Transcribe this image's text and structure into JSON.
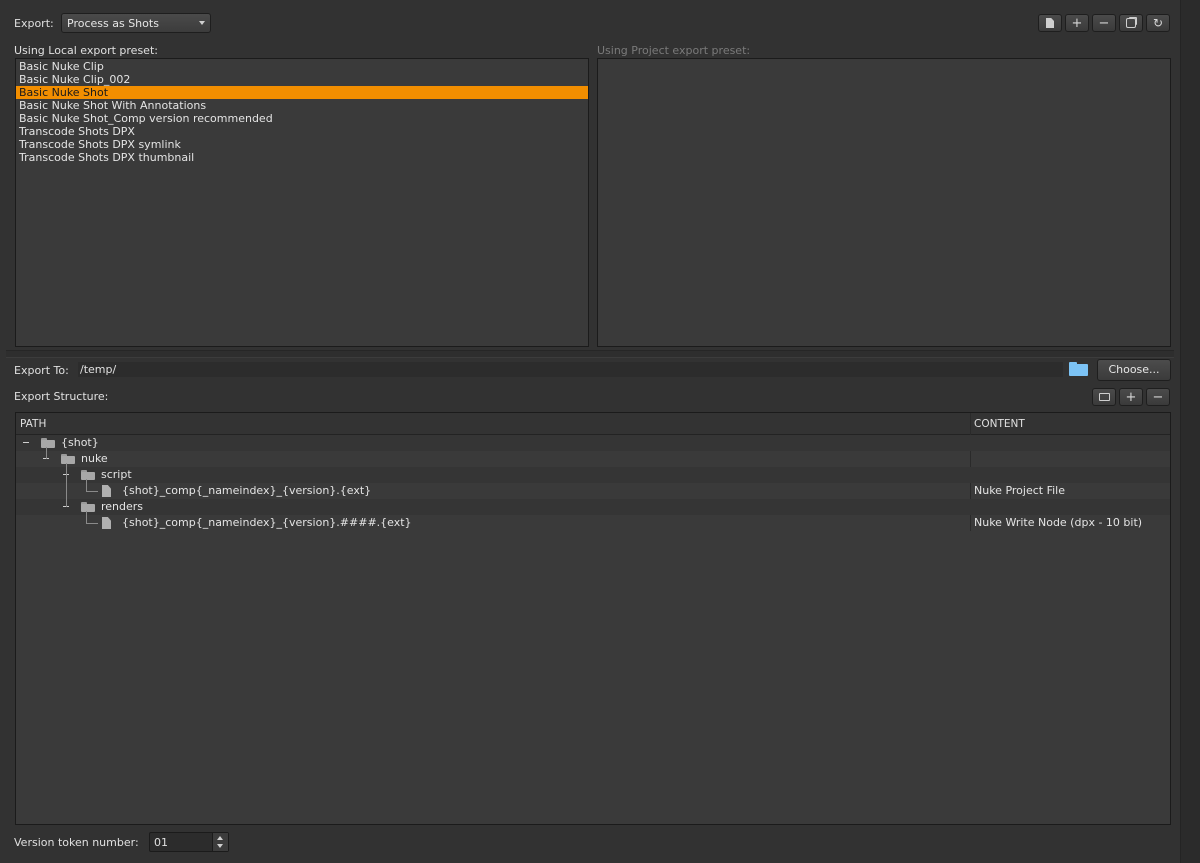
{
  "export": {
    "label": "Export:",
    "processor": "Process as Shots"
  },
  "local_presets": {
    "label": "Using Local export preset:",
    "items": [
      "Basic Nuke Clip",
      "Basic Nuke Clip_002",
      "Basic Nuke Shot",
      "Basic Nuke Shot With Annotations",
      "Basic Nuke Shot_Comp version recommended",
      "Transcode Shots DPX",
      "Transcode Shots DPX symlink",
      "Transcode Shots DPX thumbnail"
    ],
    "selected": "Basic Nuke Shot"
  },
  "project_presets": {
    "label": "Using Project export preset:"
  },
  "export_to": {
    "label": "Export To:",
    "path": "/temp/",
    "choose_label": "Choose..."
  },
  "structure": {
    "label": "Export Structure:",
    "columns": [
      "PATH",
      "CONTENT"
    ],
    "rows": [
      {
        "path": "{shot}",
        "content": ""
      },
      {
        "path": "nuke",
        "content": ""
      },
      {
        "path": "script",
        "content": ""
      },
      {
        "path": "{shot}_comp{_nameindex}_{version}.{ext}",
        "content": "Nuke Project File"
      },
      {
        "path": "renders",
        "content": ""
      },
      {
        "path": "{shot}_comp{_nameindex}_{version}.####.{ext}",
        "content": "Nuke Write Node (dpx - 10 bit)"
      }
    ]
  },
  "version_token": {
    "label": "Version token number:",
    "value": "01"
  },
  "colors": {
    "selection": "#f28e00",
    "folder_icon": "#7cc3f5"
  }
}
